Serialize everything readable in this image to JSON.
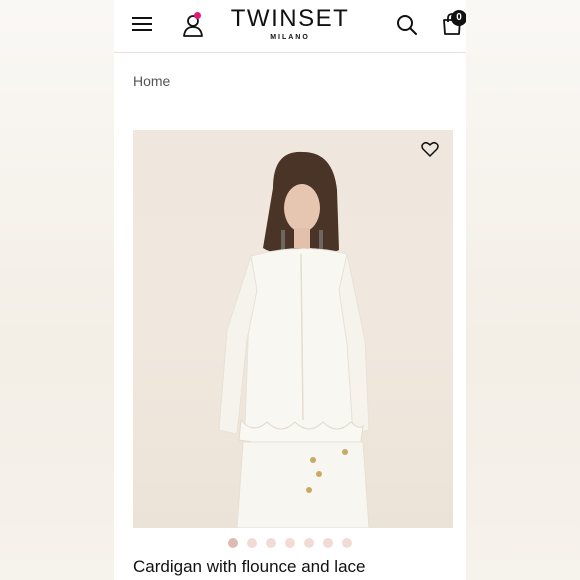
{
  "header": {
    "logo_main": "TWINSET",
    "logo_sub": "MILANO",
    "cart_count": "0",
    "notification_dot_color": "#e5157a"
  },
  "breadcrumb": {
    "home": "Home"
  },
  "product": {
    "title": "Cardigan with flounce and lace",
    "image_count": 7,
    "active_image_index": 0
  },
  "icons": {
    "menu": "hamburger-menu-icon",
    "account": "user-icon",
    "search": "search-icon",
    "cart": "shopping-bag-icon",
    "wishlist": "heart-icon"
  }
}
